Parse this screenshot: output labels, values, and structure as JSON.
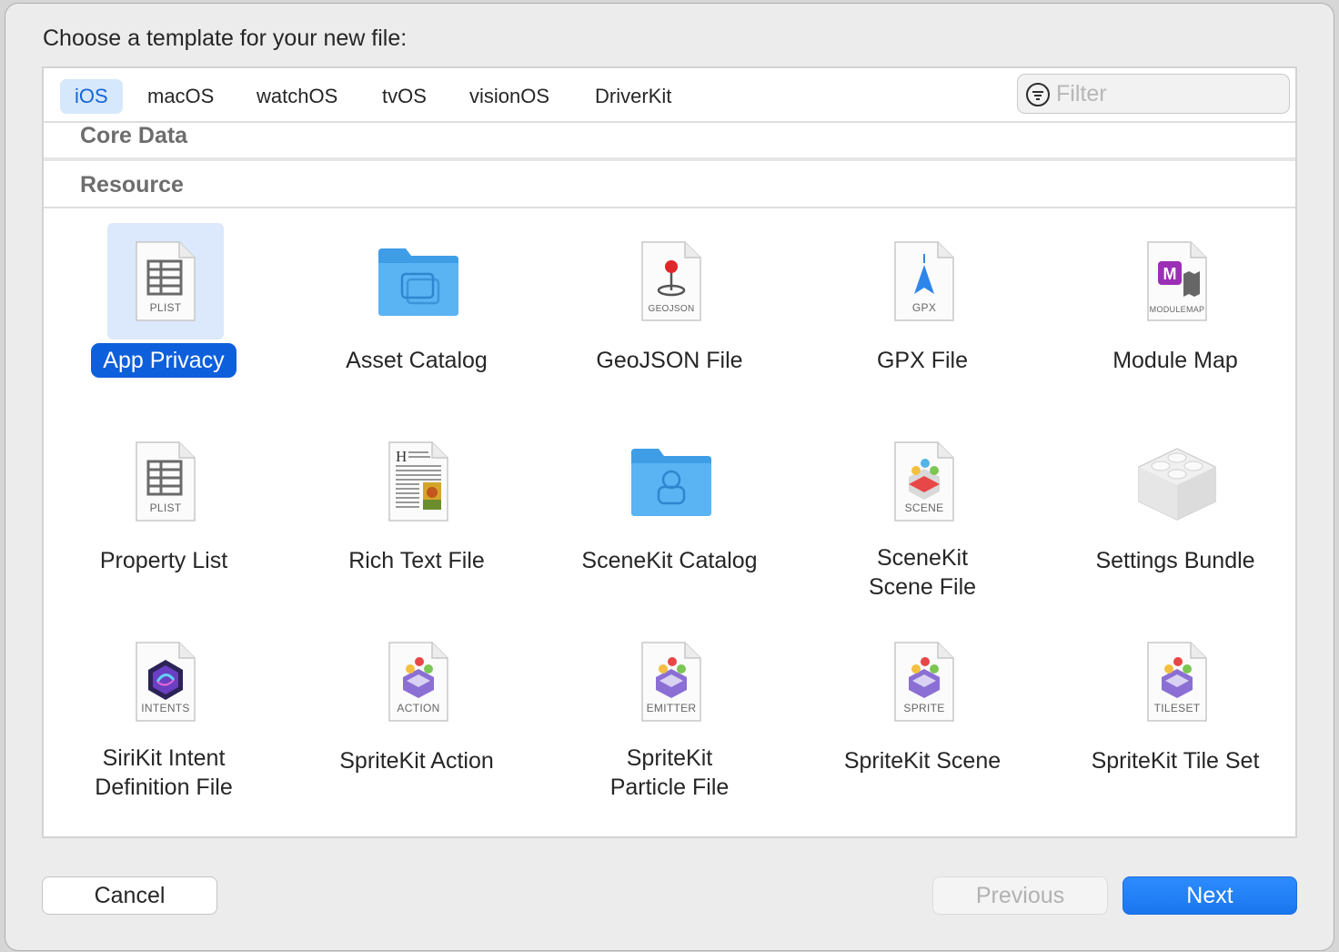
{
  "dialog": {
    "title": "Choose a template for your new file:"
  },
  "platforms": [
    {
      "label": "iOS",
      "active": true
    },
    {
      "label": "macOS"
    },
    {
      "label": "watchOS"
    },
    {
      "label": "tvOS"
    },
    {
      "label": "visionOS"
    },
    {
      "label": "DriverKit"
    }
  ],
  "filter": {
    "placeholder": "Filter",
    "value": ""
  },
  "sections": {
    "core_data": "Core Data",
    "resource": "Resource"
  },
  "templates": [
    {
      "label": "App Privacy",
      "icon": "plist-document-icon",
      "tag": "PLIST",
      "selected": true
    },
    {
      "label": "Asset Catalog",
      "icon": "asset-folder-icon"
    },
    {
      "label": "GeoJSON File",
      "icon": "geojson-document-icon",
      "tag": "GEOJSON"
    },
    {
      "label": "GPX File",
      "icon": "gpx-document-icon",
      "tag": "GPX"
    },
    {
      "label": "Module Map",
      "icon": "modulemap-document-icon",
      "tag": "MODULEMAP"
    },
    {
      "label": "Property List",
      "icon": "plist-document-icon",
      "tag": "PLIST"
    },
    {
      "label": "Rich Text File",
      "icon": "rich-text-document-icon"
    },
    {
      "label": "SceneKit Catalog",
      "icon": "scenekit-folder-icon"
    },
    {
      "label_lines": [
        "SceneKit",
        "Scene File"
      ],
      "icon": "scene-document-icon",
      "tag": "SCENE"
    },
    {
      "label": "Settings Bundle",
      "icon": "lego-brick-icon"
    },
    {
      "label_lines": [
        "SiriKit Intent",
        "Definition File"
      ],
      "icon": "intents-document-icon",
      "tag": "INTENTS"
    },
    {
      "label": "SpriteKit Action",
      "icon": "action-document-icon",
      "tag": "ACTION"
    },
    {
      "label_lines": [
        "SpriteKit",
        "Particle File"
      ],
      "icon": "emitter-document-icon",
      "tag": "EMITTER"
    },
    {
      "label": "SpriteKit Scene",
      "icon": "sprite-document-icon",
      "tag": "SPRITE"
    },
    {
      "label": "SpriteKit Tile Set",
      "icon": "tileset-document-icon",
      "tag": "TILESET"
    }
  ],
  "buttons": {
    "cancel": "Cancel",
    "previous": "Previous",
    "next": "Next"
  },
  "colors": {
    "accent": "#1a76ee",
    "selection": "#0d5fdb",
    "tab_active_bg": "#d6e8fb"
  }
}
